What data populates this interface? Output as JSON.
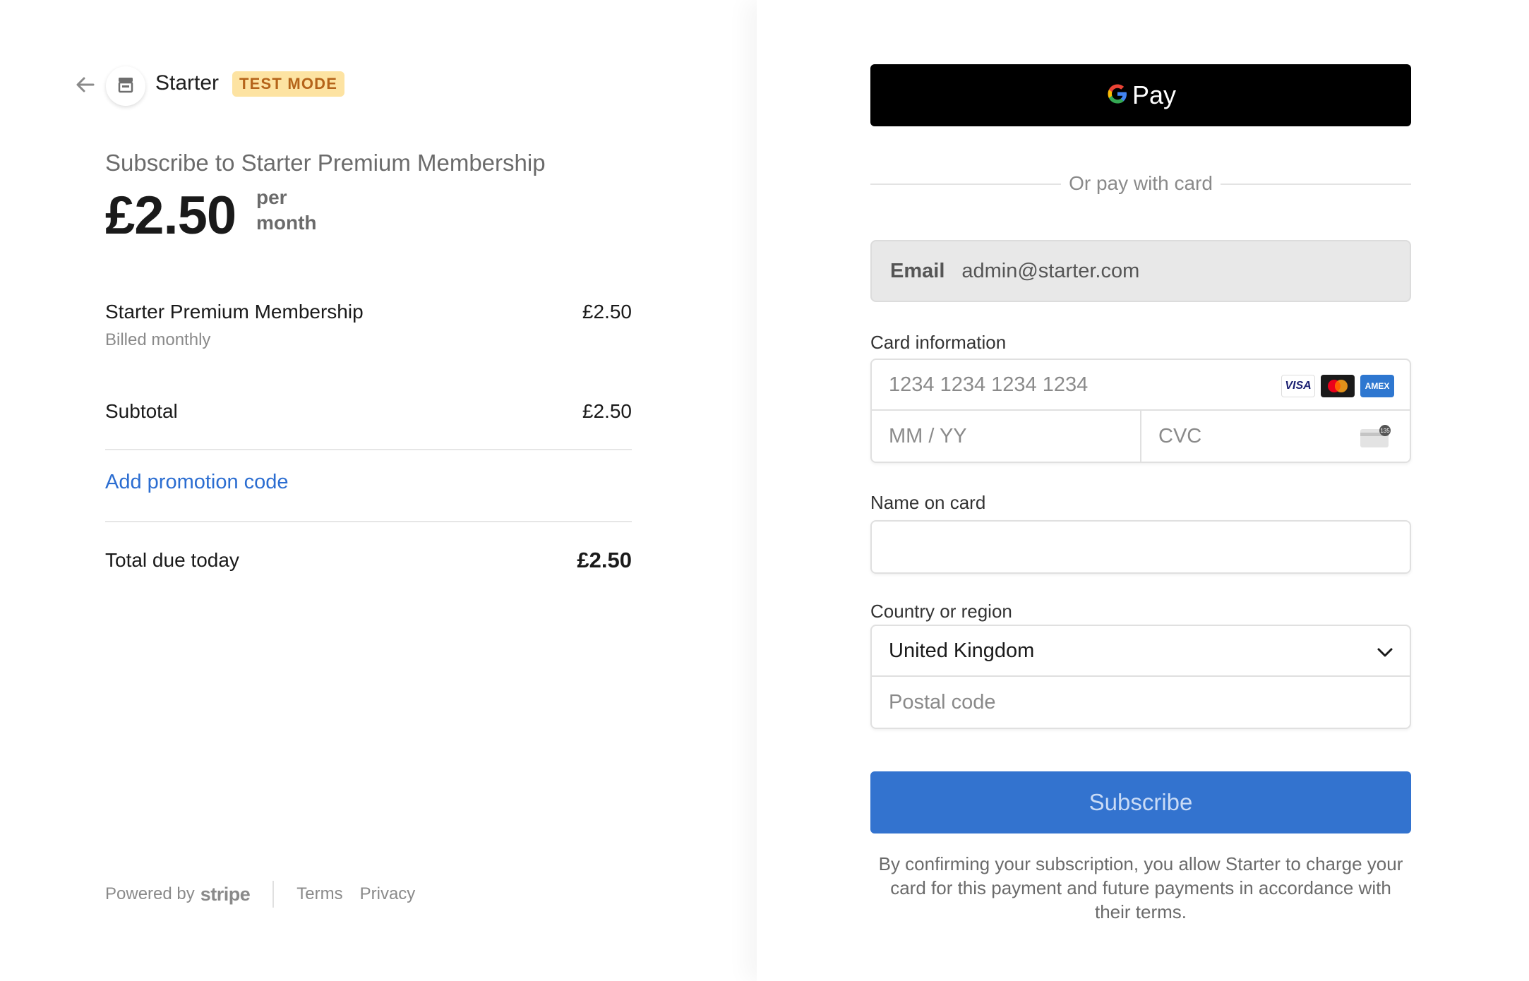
{
  "header": {
    "merchant_name": "Starter",
    "badge": "TEST MODE"
  },
  "summary": {
    "title": "Subscribe to Starter Premium Membership",
    "price": "£2.50",
    "period_line1": "per",
    "period_line2": "month"
  },
  "line_items": [
    {
      "name": "Starter Premium Membership",
      "sub": "Billed monthly",
      "amount": "£2.50"
    }
  ],
  "subtotal": {
    "label": "Subtotal",
    "amount": "£2.50"
  },
  "promo_label": "Add promotion code",
  "total": {
    "label": "Total due today",
    "amount": "£2.50"
  },
  "footer": {
    "powered_by": "Powered by",
    "brand": "stripe",
    "terms": "Terms",
    "privacy": "Privacy"
  },
  "payment": {
    "gpay_label": "Pay",
    "divider_text": "Or pay with card",
    "email_label": "Email",
    "email_value": "admin@starter.com",
    "card_info_label": "Card information",
    "card_number_placeholder": "1234 1234 1234 1234",
    "expiry_placeholder": "MM / YY",
    "cvc_placeholder": "CVC",
    "card_brands": [
      "VISA",
      "mastercard",
      "AMEX"
    ],
    "name_label": "Name on card",
    "name_value": "",
    "country_label": "Country or region",
    "country_value": "United Kingdom",
    "postal_placeholder": "Postal code",
    "subscribe_label": "Subscribe",
    "legal_text": "By confirming your subscription, you allow Starter to charge your card for this payment and future payments in accordance with their terms."
  },
  "colors": {
    "accent": "#3373cf",
    "link": "#2b6dd1",
    "badge_bg": "#fde3a2",
    "badge_text": "#b5641a"
  },
  "icons": {
    "back": "arrow-left-icon",
    "logo": "store-icon",
    "google": "google-g-icon",
    "chevron": "chevron-down-icon",
    "cvc": "card-cvc-icon"
  }
}
